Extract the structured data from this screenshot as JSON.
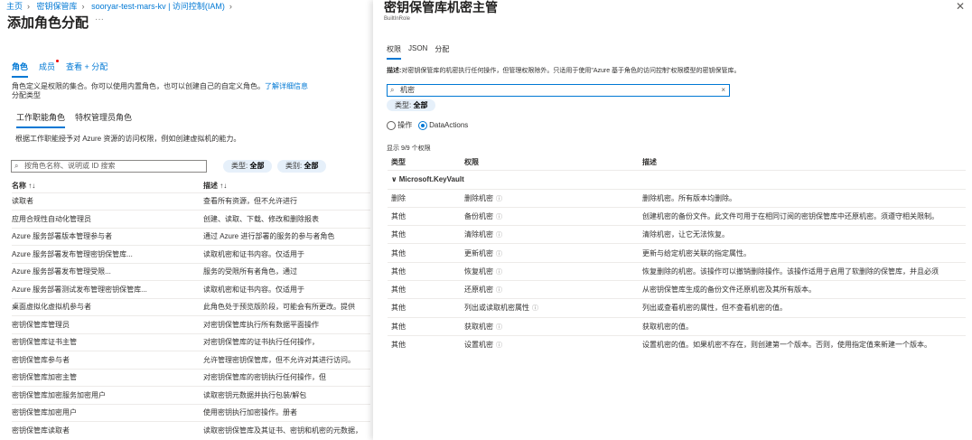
{
  "breadcrumb": [
    "主页",
    "密钥保管库",
    "sooryar-test-mars-kv | 访问控制(IAM)"
  ],
  "page_title": "添加角色分配",
  "more": "···",
  "tabs": [
    "角色",
    "成员",
    "查看 + 分配"
  ],
  "role_desc": "角色定义是权限的集合。你可以使用内置角色，也可以创建自己的自定义角色。",
  "learn_more": "了解详细信息",
  "assignment_type": "分配类型",
  "subtabs": [
    "工作职能角色",
    "特权管理员角色"
  ],
  "subtab_desc": "根据工作职能授予对 Azure 资源的访问权限，例如创建虚拟机的能力。",
  "search_placeholder": "按角色名称、说明或 ID 搜索",
  "filters": [
    {
      "label": "类型: ",
      "value": "全部"
    },
    {
      "label": "类别: ",
      "value": "全部"
    }
  ],
  "role_table": {
    "headers": [
      "名称 ↑↓",
      "描述 ↑↓"
    ],
    "rows": [
      [
        "读取者",
        "查看所有资源，但不允许进行"
      ],
      [
        "应用合规性自动化管理员",
        "创建、读取、下载、修改和删除报表"
      ],
      [
        "Azure 服务部署版本管理参与者",
        "通过 Azure 进行部署的服务的参与者角色"
      ],
      [
        "Azure 服务部署发布管理密钥保管库...",
        "读取机密和证书内容。仅适用于"
      ],
      [
        "Azure 服务部署发布管理受限...",
        "服务的受限所有者角色，通过"
      ],
      [
        "Azure 服务部署测试发布管理密钥保管库...",
        "读取机密和证书内容。仅适用于"
      ],
      [
        "桌面虚拟化虚拟机参与者",
        "此角色处于预览版阶段，可能会有所更改。提供"
      ],
      [
        "密钥保管库管理员",
        "对密钥保管库执行所有数据平面操作"
      ],
      [
        "密钥保管库证书主管",
        "对密钥保管库的证书执行任何操作，"
      ],
      [
        "密钥保管库参与者",
        "允许管理密钥保管库，但不允许对其进行访问。"
      ],
      [
        "密钥保管库加密主管",
        "对密钥保管库的密钥执行任何操作，但"
      ],
      [
        "密钥保管库加密服务加密用户",
        "读取密钥元数据并执行包装/解包"
      ],
      [
        "密钥保管库加密用户",
        "使用密钥执行加密操作。册者"
      ],
      [
        "密钥保管库读取者",
        "读取密钥保管库及其证书、密钥和机密的元数据，"
      ]
    ]
  },
  "panel": {
    "title": "密钥保管库机密主管",
    "subtitle": "BuiltInRole",
    "tabs": [
      "权限",
      "JSON",
      "分配"
    ],
    "desc_label": "描述:",
    "desc": "对密钥保管库的机密执行任何操作，但管理权限除外。只适用于使用\"Azure 基于角色的访问控制\"权限模型的密钥保管库。",
    "search_value": "机密",
    "type_filter": {
      "label": "类型: ",
      "value": "全部"
    },
    "radios": [
      "操作",
      "DataActions"
    ],
    "count": "显示 9/9 个权限",
    "headers": [
      "类型",
      "权限",
      "描述"
    ],
    "group": "Microsoft.KeyVault",
    "rows": [
      [
        "删除",
        "删除机密",
        "删除机密。所有版本均删除。"
      ],
      [
        "其他",
        "备份机密",
        "创建机密的备份文件。此文件可用于在相同订阅的密钥保管库中还原机密。须遵守相关限制。"
      ],
      [
        "其他",
        "清除机密",
        "清除机密，让它无法恢复。"
      ],
      [
        "其他",
        "更新机密",
        "更新与给定机密关联的指定属性。"
      ],
      [
        "其他",
        "恢复机密",
        "恢复删除的机密。该操作可以撤销删除操作。该操作适用于启用了软删除的保管库，并且必须"
      ],
      [
        "其他",
        "还原机密",
        "从密钥保管库生成的备份文件还原机密及其所有版本。"
      ],
      [
        "其他",
        "列出或读取机密属性",
        "列出或查看机密的属性，但不查看机密的值。"
      ],
      [
        "其他",
        "获取机密",
        "获取机密的值。"
      ],
      [
        "其他",
        "设置机密",
        "设置机密的值。如果机密不存在，则创建第一个版本。否则，使用指定值来新建一个版本。"
      ]
    ]
  }
}
